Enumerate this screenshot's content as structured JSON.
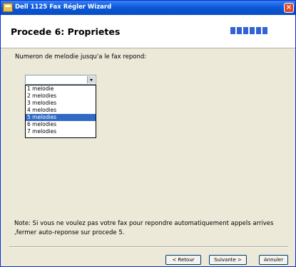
{
  "window": {
    "title": "Dell 1125 Fax Régler Wizard",
    "close_glyph": "×"
  },
  "header": {
    "title": "Procede 6: Proprietes",
    "progress_steps": 6,
    "progress_completed": 6
  },
  "main": {
    "prompt": "Numeron de melodie jusqu'a le fax repond:",
    "combo_value": "",
    "options": [
      "1 melodie",
      "2 melodies",
      "3 melodies",
      "4 melodies",
      "5 melodies",
      "6 melodies",
      "7 melodies"
    ],
    "highlighted_option": "5 melodies",
    "note": "Note: Si vous ne voulez pas votre fax pour repondre automatiquement appels arrives ,fermer auto-reponse sur procede 5."
  },
  "buttons": {
    "back_label": "< Retour",
    "next_label": "Suivante >",
    "cancel_label": "Annuler"
  },
  "colors": {
    "titlebar": "#0A57D6",
    "progress": "#3262d4",
    "highlight": "#316AC5"
  }
}
